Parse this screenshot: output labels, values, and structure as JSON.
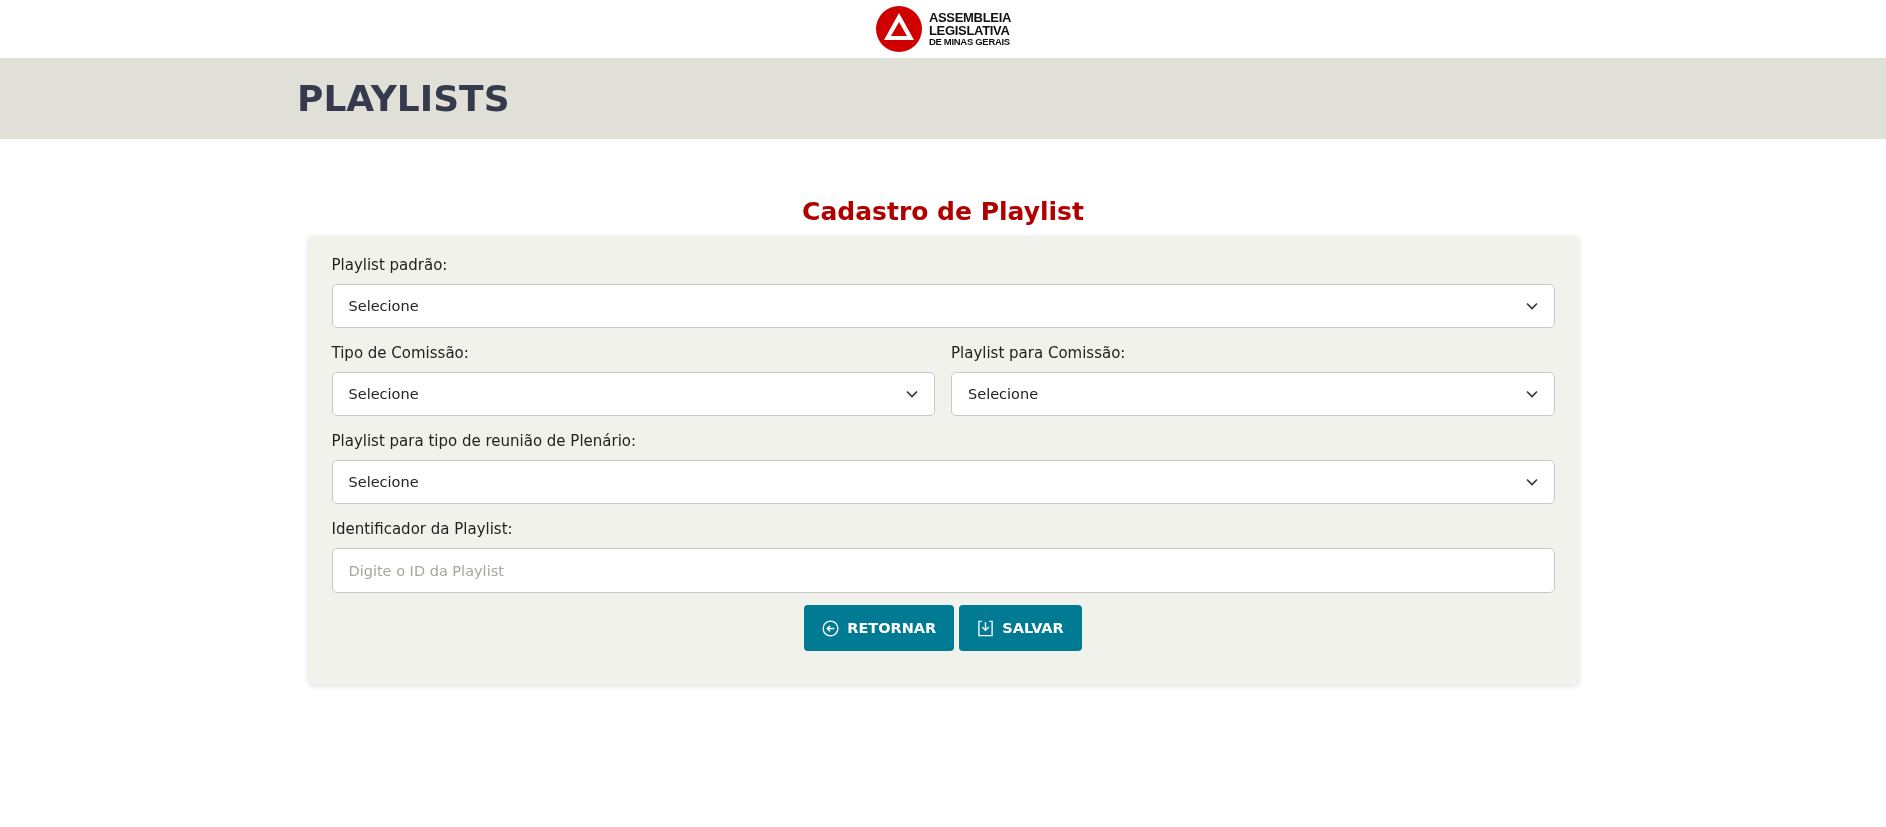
{
  "logo": {
    "lines": [
      "ASSEMBLEIA",
      "LEGISLATIVA",
      "DE MINAS GERAIS"
    ]
  },
  "page_header": {
    "title": "PLAYLISTS"
  },
  "form": {
    "title": "Cadastro de Playlist",
    "rows": [
      [
        {
          "kind": "select",
          "label": "Playlist padrão:",
          "value": "Selecione"
        }
      ],
      [
        {
          "kind": "select",
          "label": "Tipo de Comissão:",
          "value": "Selecione"
        },
        {
          "kind": "select",
          "label": "Playlist para Comissão:",
          "value": "Selecione"
        }
      ],
      [
        {
          "kind": "select",
          "label": "Playlist para tipo de reunião de Plenário:",
          "value": "Selecione"
        }
      ],
      [
        {
          "kind": "text",
          "label": "Identificador da Playlist:",
          "placeholder": "Digite o ID da Playlist"
        }
      ]
    ],
    "buttons": [
      {
        "kind": "back",
        "label": "RETORNAR"
      },
      {
        "kind": "save",
        "label": "SALVAR"
      }
    ]
  }
}
